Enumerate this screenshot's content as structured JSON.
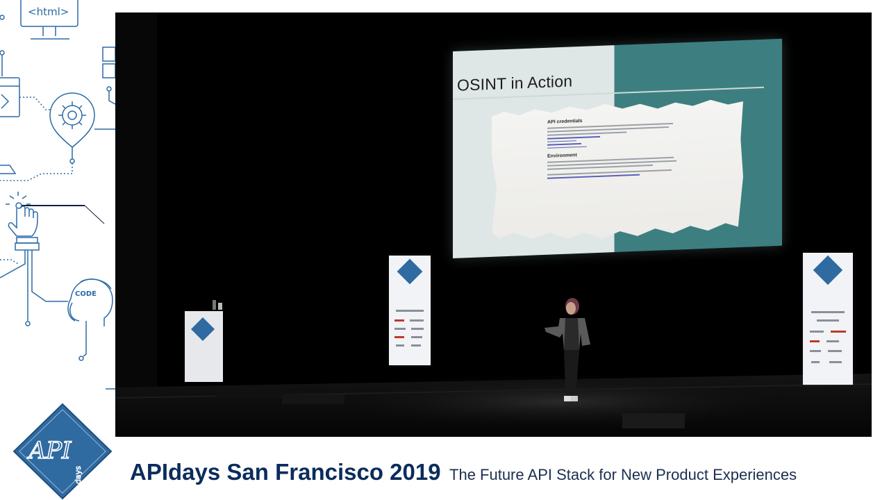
{
  "illustration": {
    "html_tag": "<html>",
    "code_label": "CODE"
  },
  "stage": {
    "slide": {
      "title": "OSINT in Action",
      "section_heading": "API credentials",
      "subsection_heading": "Environment"
    }
  },
  "logo": {
    "text_main": "API",
    "text_sub": "days"
  },
  "footer": {
    "event_title": "APIdays San Francisco 2019",
    "event_subtitle": "The Future API Stack for New Product Experiences"
  },
  "colors": {
    "brand_blue": "#2f6aa1",
    "navy_text": "#0b2c5c",
    "slide_teal": "#3d7f80"
  }
}
